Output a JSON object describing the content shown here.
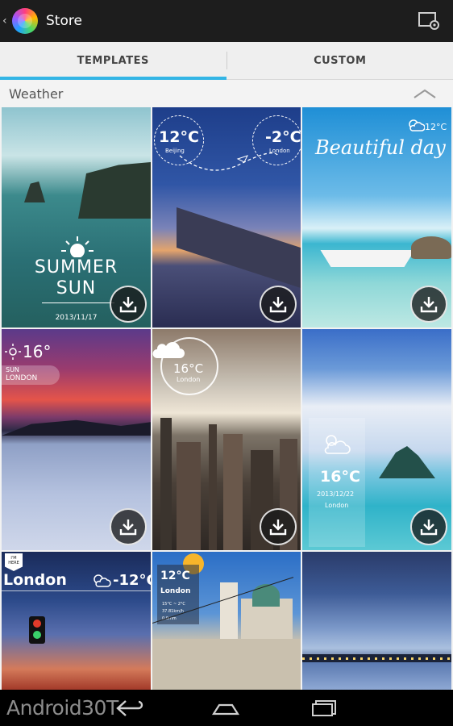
{
  "header": {
    "title": "Store"
  },
  "tabs": [
    {
      "label": "TEMPLATES",
      "active": true
    },
    {
      "label": "CUSTOM",
      "active": false
    }
  ],
  "section": {
    "label": "Weather"
  },
  "tiles": [
    {
      "id": "summer-sun",
      "title_line1": "SUMMER",
      "title_line2": "SUN",
      "date": "2013/11/17"
    },
    {
      "id": "flight",
      "left_temp": "12°C",
      "left_city": "Beijing",
      "right_temp": "-2°C",
      "right_city": "London"
    },
    {
      "id": "beautiful-day",
      "temp": "12°C",
      "caption": "Beautiful day"
    },
    {
      "id": "sunset-lake",
      "temp": "16°",
      "day": "SUN",
      "city": "LONDON"
    },
    {
      "id": "city-skyline",
      "temp": "16°C",
      "city": "London"
    },
    {
      "id": "island",
      "temp": "16°C",
      "date": "2013/12/22",
      "city": "London"
    },
    {
      "id": "traffic",
      "tag": "I'M HERE",
      "city": "London",
      "temp": "-12°C"
    },
    {
      "id": "cathedral",
      "temp": "12°C",
      "city": "London",
      "detail1": "15°C ~ 2°C",
      "detail2": "37.81km/h",
      "detail3": "0.0mm"
    },
    {
      "id": "harbor"
    }
  ],
  "watermark": "Android30T",
  "colors": {
    "accent": "#33b5e5",
    "actionbar": "#1d1d1d",
    "tabs_bg": "#efefef"
  }
}
